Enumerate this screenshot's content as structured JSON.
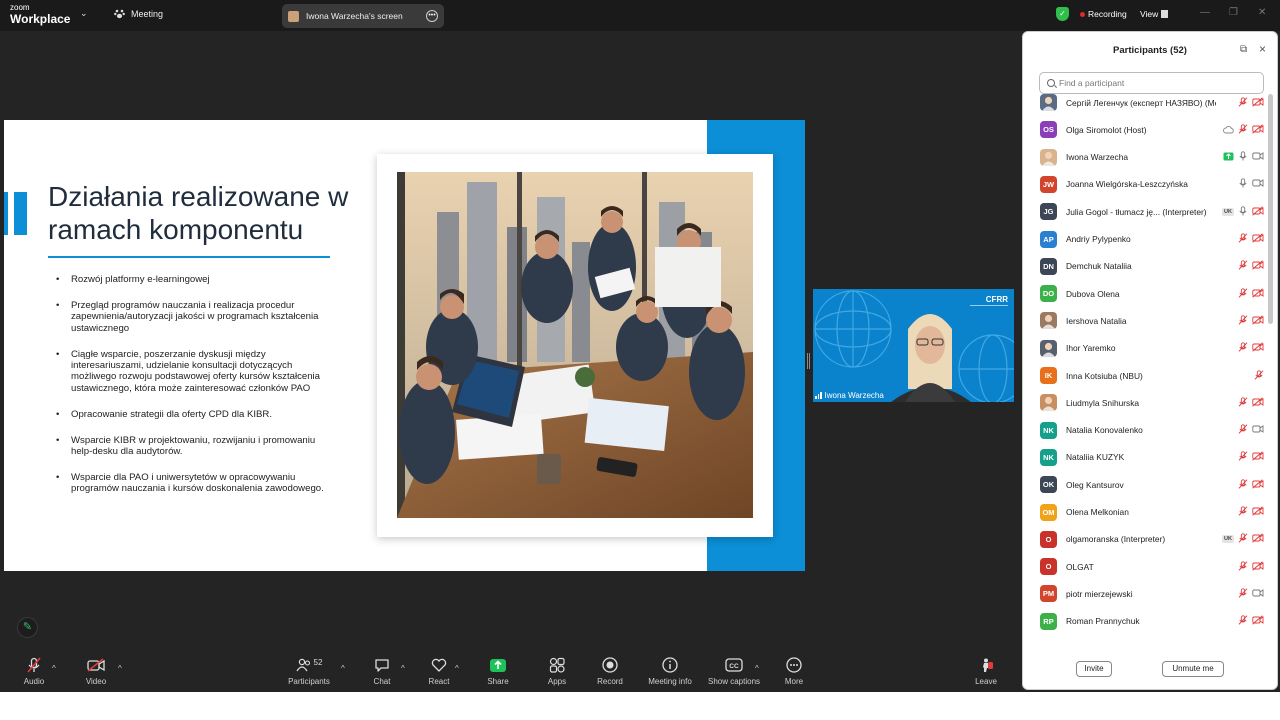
{
  "app": {
    "logo_top": "zoom",
    "logo_bottom": "Workplace",
    "meeting_label": "Meeting",
    "share_tab_label": "Iwona Warzecha's screen",
    "recording_label": "Recording",
    "view_label": "View"
  },
  "slide": {
    "title": "Działania realizowane w ramach komponentu",
    "bullets": [
      "Rozwój platformy e-learningowej",
      "Przegląd programów nauczania i realizacja procedur zapewnienia/autoryzacji jakości w programach kształcenia ustawicznego",
      "Ciągłe wsparcie, poszerzanie dyskusji między interesariuszami, udzielanie konsultacji dotyczących możliwego rozwoju podstawowej oferty kursów kształcenia ustawicznego, która może zainteresować członków PAO",
      "Opracowanie strategii dla oferty CPD dla KIBR.",
      "Wsparcie KIBR w projektowaniu, rozwijaniu i promowaniu help-desku dla audytorów.",
      "Wsparcie dla PAO i uniwersytetów w opracowywaniu programów nauczania i kursów doskonalenia zawodowego."
    ]
  },
  "video": {
    "name": "Iwona Warzecha",
    "logo_text": "CFRR"
  },
  "toolbar": {
    "audio": "Audio",
    "video": "Video",
    "participants": "Participants",
    "participants_count": "52",
    "chat": "Chat",
    "react": "React",
    "share": "Share",
    "apps": "Apps",
    "record": "Record",
    "meeting_info": "Meeting info",
    "show_captions": "Show captions",
    "more": "More",
    "leave": "Leave"
  },
  "panel": {
    "title": "Participants (52)",
    "search_placeholder": "Find a participant",
    "invite_label": "Invite",
    "unmute_label": "Unmute me",
    "participants": [
      {
        "initials": "",
        "name": "Сергій Легенчук (експерт НАЗЯВО) (Me)",
        "color": "#5a6b84",
        "photo": true,
        "uk": false,
        "mic": "off",
        "video": "off"
      },
      {
        "initials": "OS",
        "name": "Olga Siromolot (Host)",
        "color": "#8a3fb8",
        "photo": false,
        "uk": false,
        "mic": "off",
        "video": "off",
        "cloud": true
      },
      {
        "initials": "",
        "name": "Iwona Warzecha",
        "color": "#d9b38c",
        "photo": true,
        "uk": false,
        "mic": "on",
        "video": "on",
        "sharing": true
      },
      {
        "initials": "JW",
        "name": "Joanna Wielgórska-Leszczyńska",
        "color": "#d0452b",
        "photo": false,
        "uk": false,
        "mic": "on",
        "video": "on"
      },
      {
        "initials": "JG",
        "name": "Julia Gogol - tłumacz ję... (Interpreter)",
        "color": "#3c4654",
        "photo": false,
        "uk": true,
        "mic": "on",
        "video": "off"
      },
      {
        "initials": "AP",
        "name": "Andriy Pylypenko",
        "color": "#2b7fd0",
        "photo": false,
        "uk": false,
        "mic": "off",
        "video": "off"
      },
      {
        "initials": "DN",
        "name": "Demchuk Nataliia",
        "color": "#3c4654",
        "photo": false,
        "uk": false,
        "mic": "off",
        "video": "off"
      },
      {
        "initials": "DO",
        "name": "Dubova Olena",
        "color": "#3cb14a",
        "photo": false,
        "uk": false,
        "mic": "off",
        "video": "off"
      },
      {
        "initials": "",
        "name": "Iershova Natalia",
        "color": "#9a7a62",
        "photo": true,
        "uk": false,
        "mic": "off",
        "video": "off"
      },
      {
        "initials": "",
        "name": "Ihor Yaremko",
        "color": "#56606e",
        "photo": true,
        "uk": false,
        "mic": "off",
        "video": "off"
      },
      {
        "initials": "IK",
        "name": "Inna Kotsiuba (NBU)",
        "color": "#e8701a",
        "photo": false,
        "uk": false,
        "mic": "off",
        "video": "none"
      },
      {
        "initials": "",
        "name": "Liudmyla Snihurska",
        "color": "#c89060",
        "photo": true,
        "uk": false,
        "mic": "off",
        "video": "off"
      },
      {
        "initials": "NK",
        "name": "Natalia Konovalenko",
        "color": "#14a08a",
        "photo": false,
        "uk": false,
        "mic": "off",
        "video": "on"
      },
      {
        "initials": "NK",
        "name": "Nataliia KUZYK",
        "color": "#14a08a",
        "photo": false,
        "uk": false,
        "mic": "off",
        "video": "off"
      },
      {
        "initials": "OK",
        "name": "Oleg Kantsurov",
        "color": "#3c4654",
        "photo": false,
        "uk": false,
        "mic": "off",
        "video": "off"
      },
      {
        "initials": "OM",
        "name": "Olena Melkonian",
        "color": "#f0a31a",
        "photo": false,
        "uk": false,
        "mic": "off",
        "video": "off"
      },
      {
        "initials": "O",
        "name": "olgamoranska (Interpreter)",
        "color": "#c8322a",
        "photo": false,
        "uk": true,
        "mic": "off",
        "video": "off"
      },
      {
        "initials": "O",
        "name": "OLGAT",
        "color": "#c8322a",
        "photo": false,
        "uk": false,
        "mic": "off",
        "video": "off"
      },
      {
        "initials": "PM",
        "name": "piotr mierzejewski",
        "color": "#d0452b",
        "photo": false,
        "uk": false,
        "mic": "off",
        "video": "on"
      },
      {
        "initials": "RP",
        "name": "Roman Prannychuk",
        "color": "#3cb14a",
        "photo": false,
        "uk": false,
        "mic": "off",
        "video": "off"
      }
    ]
  }
}
